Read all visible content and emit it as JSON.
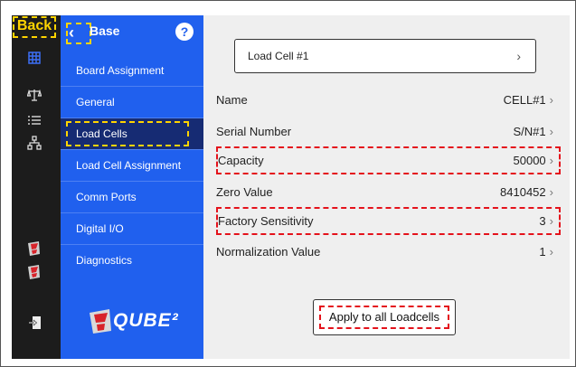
{
  "rail": {
    "back_label": "Back",
    "icons": [
      "grid-icon",
      "scale-icon",
      "list-icon",
      "network-icon",
      "flask-icon",
      "flask-icon",
      "logout-icon"
    ]
  },
  "nav": {
    "title": "Base",
    "help": "?",
    "items": [
      {
        "label": "Board Assignment"
      },
      {
        "label": "General"
      },
      {
        "label": "Load Cells",
        "active": true
      },
      {
        "label": "Load Cell Assignment"
      },
      {
        "label": "Comm Ports"
      },
      {
        "label": "Digital I/O"
      },
      {
        "label": "Diagnostics"
      }
    ],
    "logo_text": "QUBE²"
  },
  "content": {
    "selector": {
      "label": "Load Cell #1",
      "chevron": "›"
    },
    "rows": [
      {
        "label": "Name",
        "value": "CELL#1"
      },
      {
        "label": "Serial Number",
        "value": "S/N#1"
      },
      {
        "label": "Capacity",
        "value": "50000",
        "highlight": true
      },
      {
        "label": "Zero Value",
        "value": "8410452"
      },
      {
        "label": "Factory Sensitivity",
        "value": "3",
        "highlight": true
      },
      {
        "label": "Normalization Value",
        "value": "1"
      }
    ],
    "apply_label": "Apply to all Loadcells"
  },
  "colors": {
    "nav_blue": "#2060ee",
    "nav_active": "#162b73",
    "rail": "#1c1c1c",
    "yellow_hl": "#ffd400",
    "red_hl": "#e4121b"
  }
}
